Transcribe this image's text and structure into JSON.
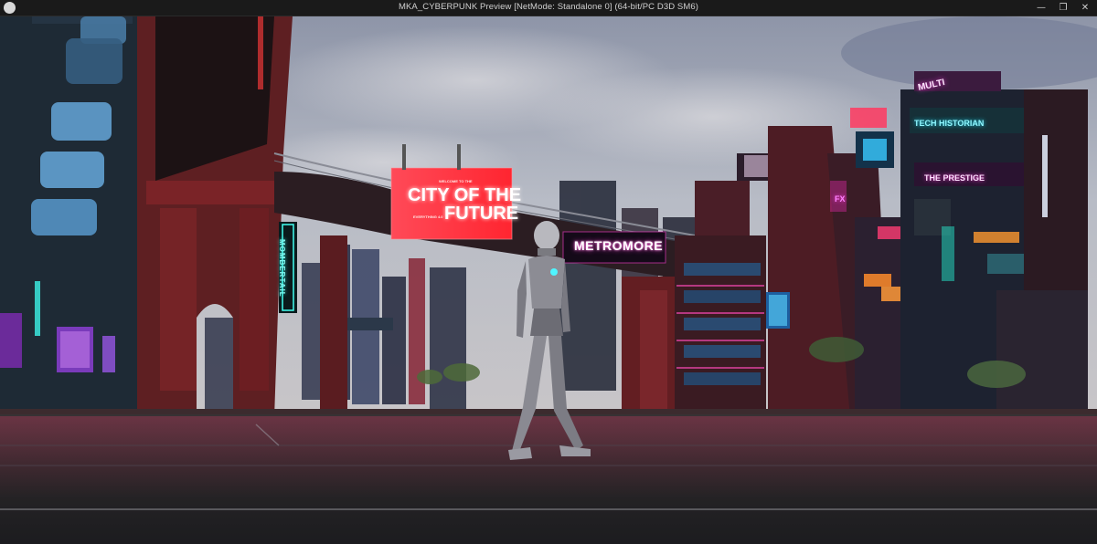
{
  "window": {
    "title": "MKA_CYBERPUNK Preview [NetMode: Standalone 0]  (64-bit/PC D3D SM6)",
    "minimize_glyph": "—",
    "maximize_glyph": "❐",
    "close_glyph": "✕"
  },
  "scene": {
    "billboard": {
      "welcome": "WELCOME TO THE",
      "headline_line1": "CITY OF THE",
      "headline_line2": "FUTURE",
      "footer": "EVERYTHING 4.0"
    },
    "bridge_sign": "METROMORE",
    "vertical_sign": "MOMBERTAIL",
    "tower_signs": {
      "tech": "TECH HISTORIAN",
      "prestige": "THE PRESTIGE",
      "multi": "MULTI",
      "fx": "FX"
    }
  },
  "colors": {
    "titlebar": "#1a1a1a",
    "sky_top": "#9aa1b4",
    "neon_pink": "#ff3fd0",
    "neon_cyan": "#41fff0",
    "billboard_red": "#ff2b35",
    "street": "#2a2a2e"
  }
}
